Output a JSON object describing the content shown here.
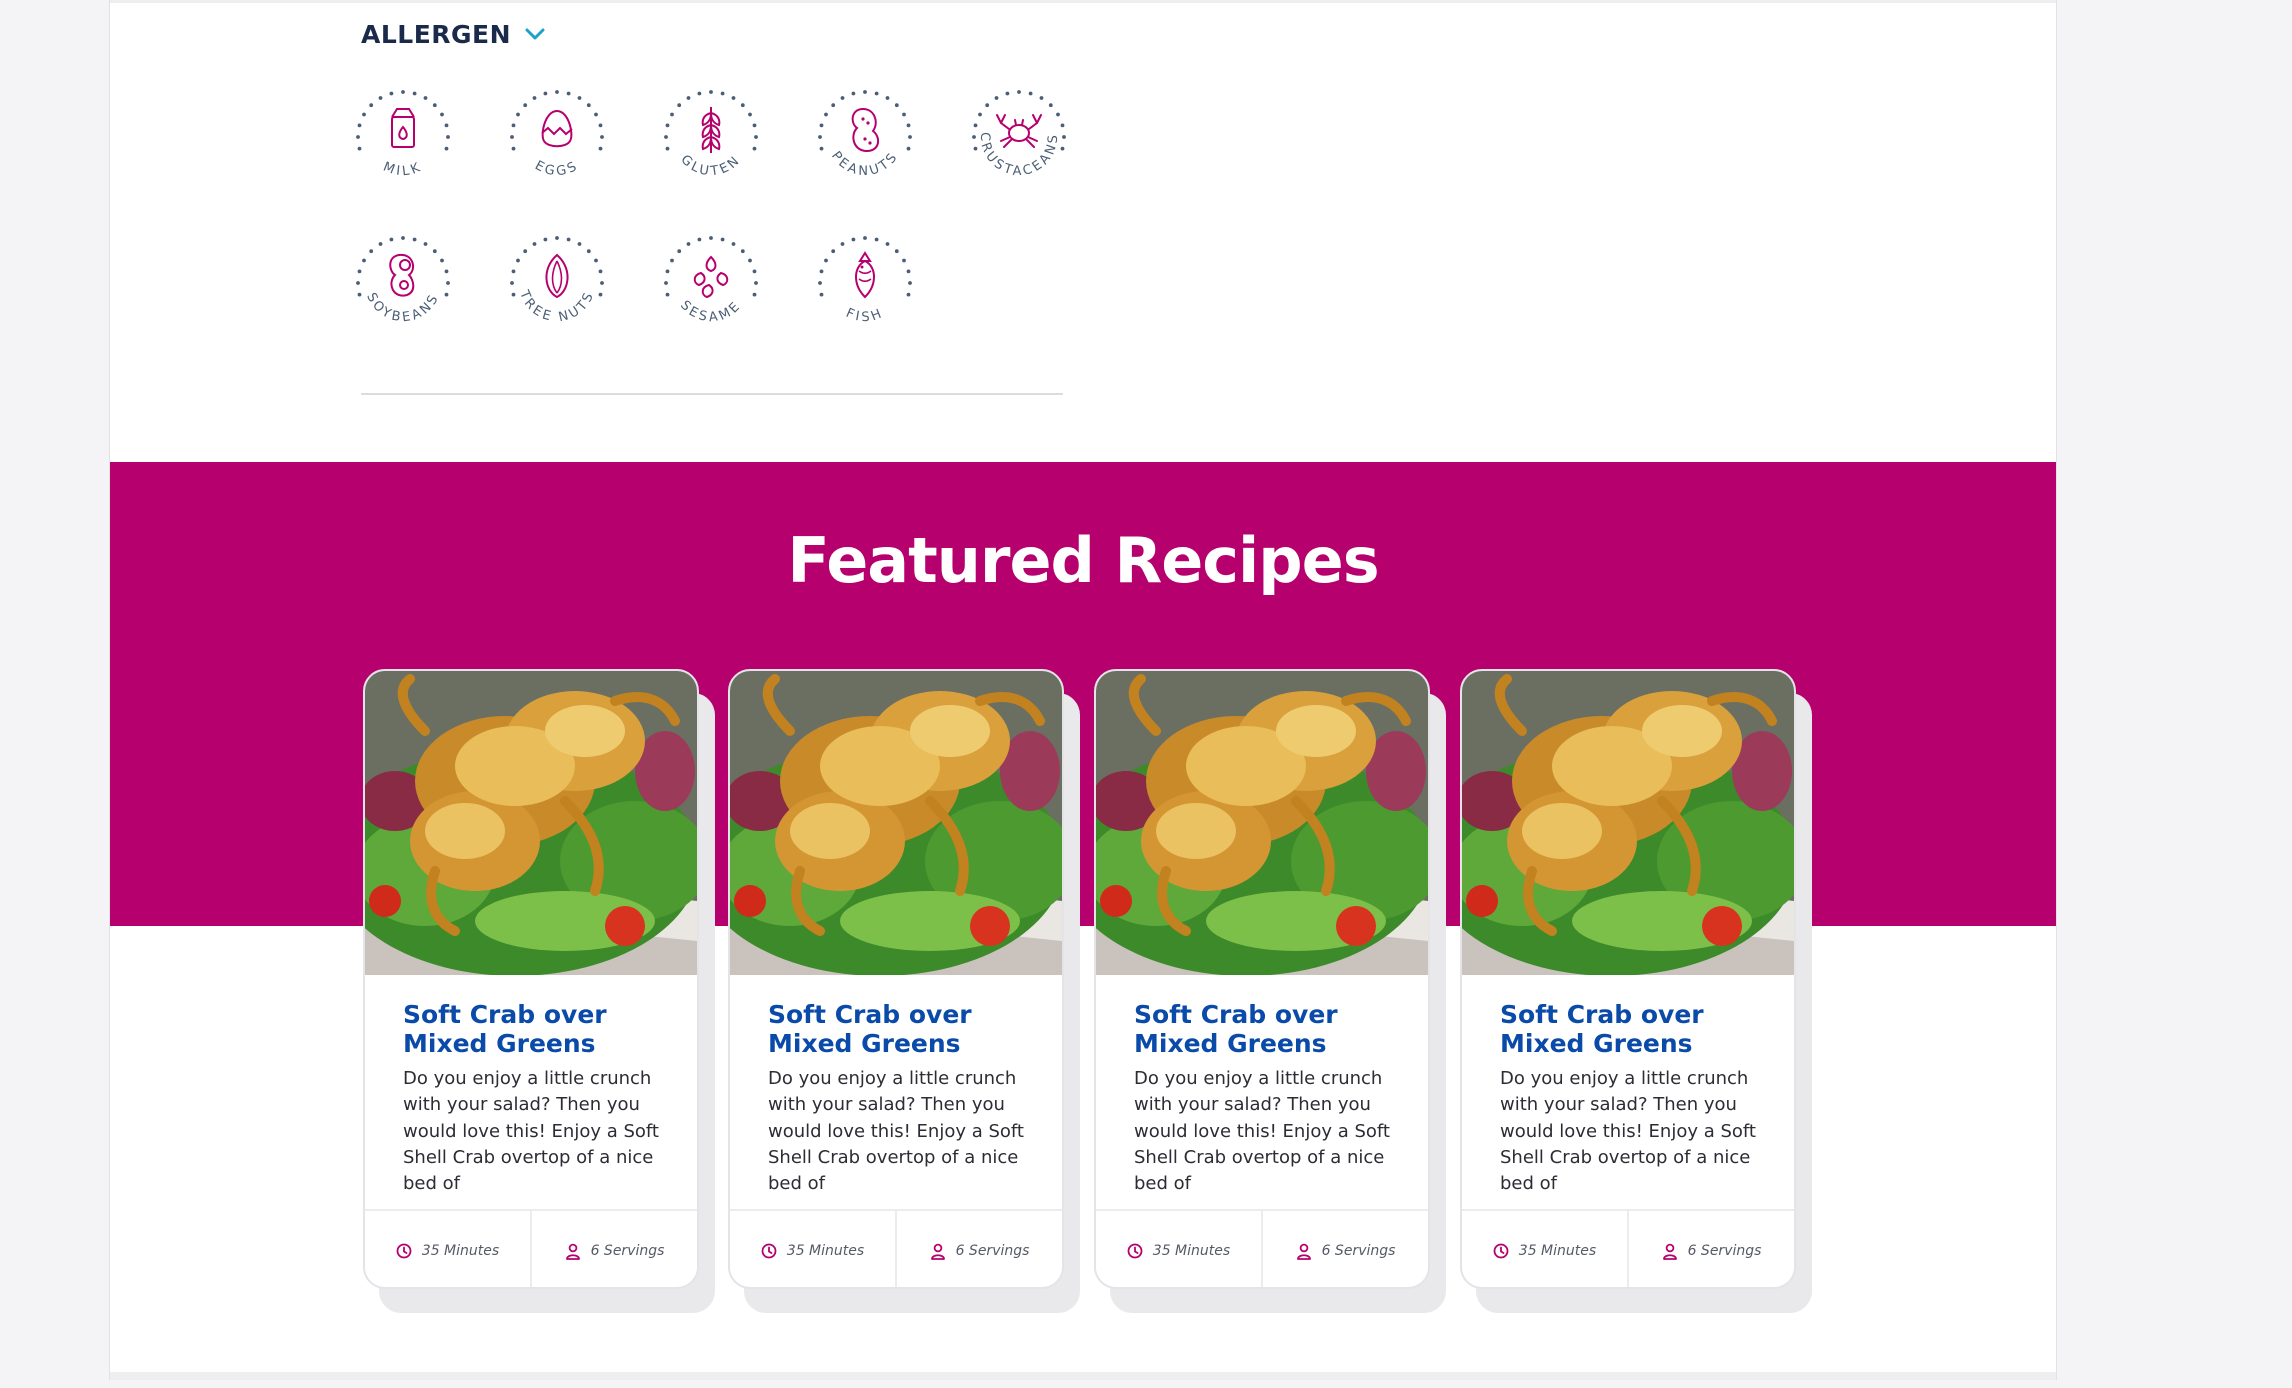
{
  "allergen_filter": {
    "title": "ALLERGEN",
    "toggle_icon": "chevron-down-icon",
    "items": [
      {
        "label": "MILK",
        "icon": "milk-icon"
      },
      {
        "label": "EGGS",
        "icon": "egg-icon"
      },
      {
        "label": "GLUTEN",
        "icon": "wheat-icon"
      },
      {
        "label": "PEANUTS",
        "icon": "peanut-icon"
      },
      {
        "label": "CRUSTACEANS",
        "icon": "crab-icon"
      },
      {
        "label": "SOYBEANS",
        "icon": "soybean-icon"
      },
      {
        "label": "TREE NUTS",
        "icon": "almond-icon"
      },
      {
        "label": "SESAME",
        "icon": "sesame-icon"
      },
      {
        "label": "FISH",
        "icon": "fish-icon"
      }
    ]
  },
  "featured": {
    "title": "Featured Recipes",
    "recipes": [
      {
        "title": "Soft Crab over Mixed Greens",
        "description": "Do you enjoy a little crunch with your salad? Then you would love this! Enjoy a Soft Shell Crab overtop of a nice bed of",
        "time": "35 Minutes",
        "servings": "6 Servings"
      },
      {
        "title": "Soft Crab over Mixed Greens",
        "description": "Do you enjoy a little crunch with your salad? Then you would love this! Enjoy a Soft Shell Crab overtop of a nice bed of",
        "time": "35 Minutes",
        "servings": "6 Servings"
      },
      {
        "title": "Soft Crab over Mixed Greens",
        "description": "Do you enjoy a little crunch with your salad? Then you would love this! Enjoy a Soft Shell Crab overtop of a nice bed of",
        "time": "35 Minutes",
        "servings": "6 Servings"
      },
      {
        "title": "Soft Crab over Mixed Greens",
        "description": "Do you enjoy a little crunch with your salad? Then you would love this! Enjoy a Soft Shell Crab overtop of a nice bed of",
        "time": "35 Minutes",
        "servings": "6 Servings"
      }
    ]
  },
  "colors": {
    "brand": "#b5006e",
    "title_blue": "#0a4aa8",
    "navy": "#1b2a4a",
    "icon_magenta": "#b5006e",
    "chevron": "#1aa2c8"
  }
}
